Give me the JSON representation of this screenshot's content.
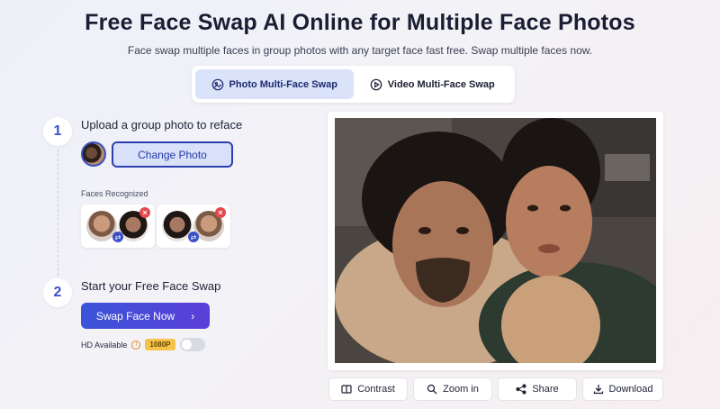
{
  "header": {
    "title": "Free Face Swap AI Online for Multiple Face Photos",
    "subtitle": "Face swap multiple faces in group photos with any target face fast free. Swap multiple faces now."
  },
  "tabs": [
    {
      "label": "Photo Multi-Face Swap",
      "icon": "image-icon",
      "active": true
    },
    {
      "label": "Video Multi-Face Swap",
      "icon": "play-circle-icon",
      "active": false
    }
  ],
  "step1": {
    "number": "1",
    "title": "Upload a group photo to reface",
    "change_photo_label": "Change Photo",
    "faces_label": "Faces Recognized"
  },
  "step2": {
    "number": "2",
    "title": "Start your Free Face Swap",
    "swap_button_label": "Swap Face Now",
    "hd_label": "HD Available",
    "hd_badge": "1080P"
  },
  "actions": [
    {
      "label": "Contrast",
      "icon": "contrast-icon"
    },
    {
      "label": "Zoom in",
      "icon": "zoom-icon"
    },
    {
      "label": "Share",
      "icon": "share-icon"
    },
    {
      "label": "Download",
      "icon": "download-icon"
    }
  ],
  "colors": {
    "accent": "#3b4fc8",
    "accent_gradient_end": "#5a3fd6",
    "danger": "#e5484d",
    "badge": "#f5c24a"
  }
}
